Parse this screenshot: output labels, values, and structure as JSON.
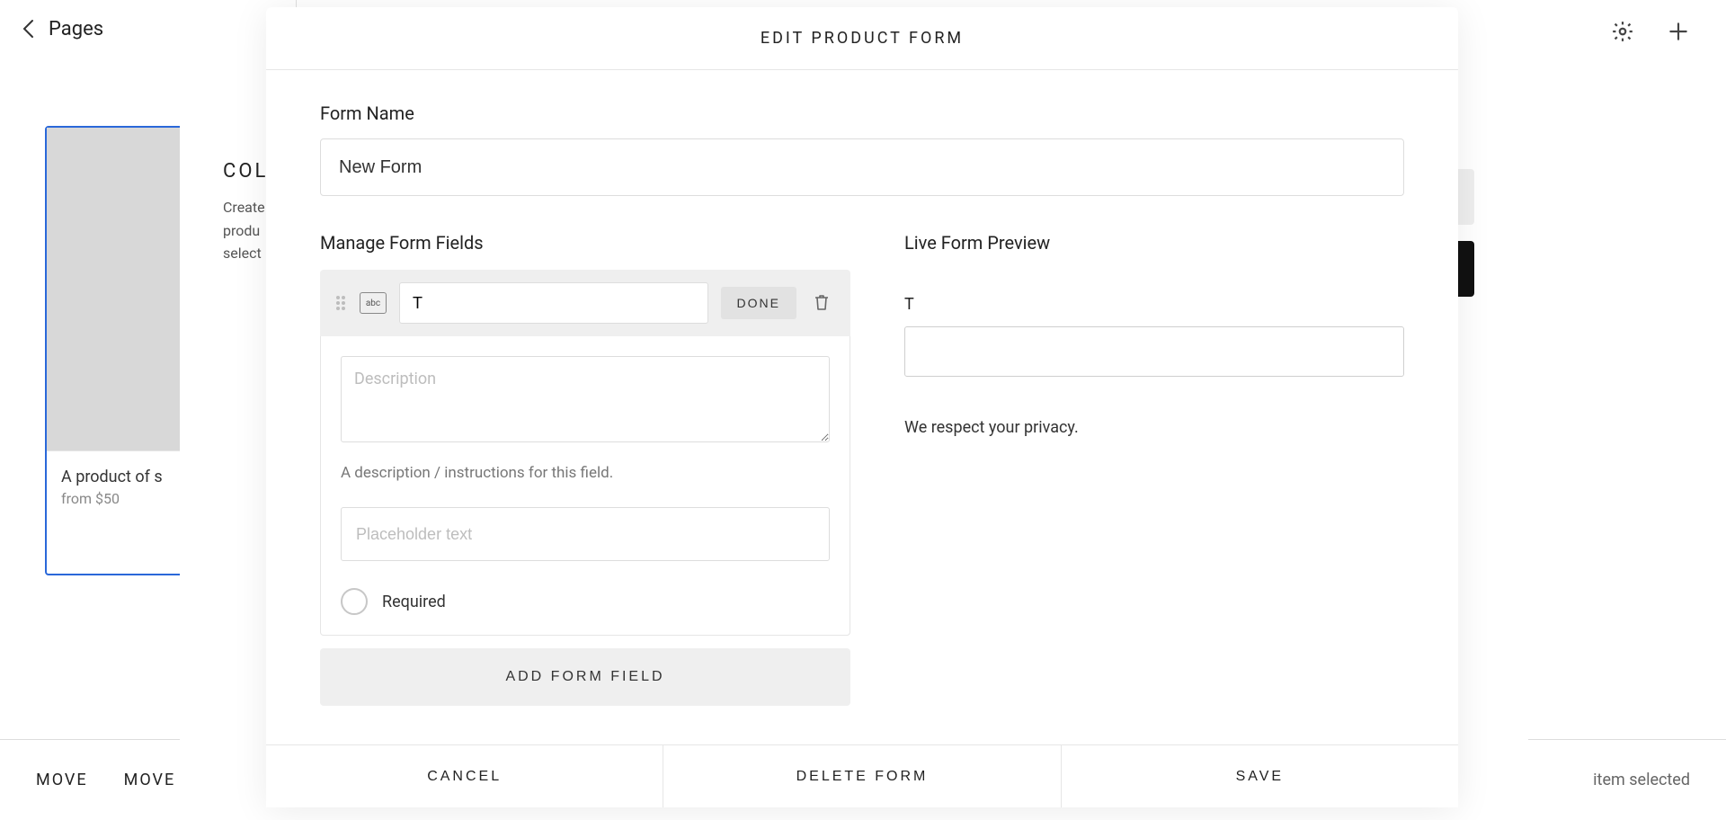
{
  "background": {
    "pages_label": "Pages",
    "product_card": {
      "title": "A product of s",
      "price_line": "from $50"
    },
    "bottom_bar": {
      "actions": [
        "MOVE",
        "MOVE TO"
      ],
      "selected_text": "item selected"
    },
    "mid_panel": {
      "heading_fragment": "COLL",
      "sub_line1": "Create",
      "sub_line2": "produ",
      "sub_line3": "select"
    }
  },
  "modal": {
    "title": "EDIT PRODUCT FORM",
    "form_name_label": "Form Name",
    "form_name_value": "New Form",
    "manage_fields_label": "Manage Form Fields",
    "live_preview_label": "Live Form Preview",
    "field_editor": {
      "type_badge": "abc",
      "title_value": "T",
      "done_label": "DONE",
      "description_placeholder": "Description",
      "description_hint": "A description / instructions for this field.",
      "placeholder_input_placeholder": "Placeholder text",
      "required_label": "Required"
    },
    "add_field_label": "ADD FORM FIELD",
    "preview": {
      "field_label": "T",
      "privacy_text": "We respect your privacy."
    },
    "footer": {
      "cancel": "CANCEL",
      "delete": "DELETE FORM",
      "save": "SAVE"
    }
  }
}
